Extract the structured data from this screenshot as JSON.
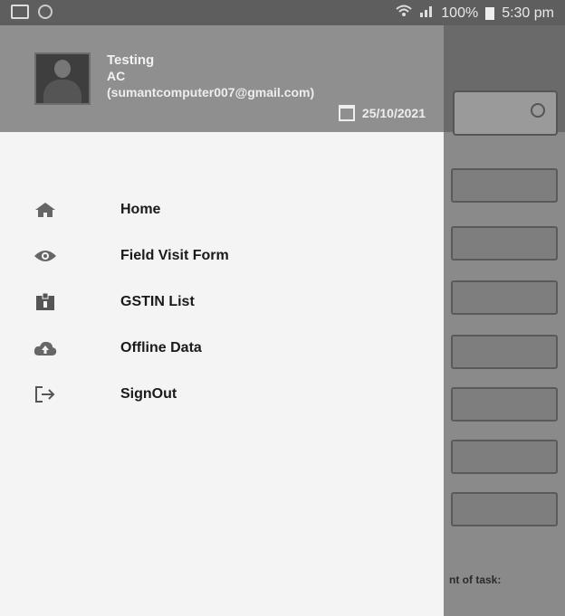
{
  "status_bar": {
    "battery": "100%",
    "time": "5:30 pm"
  },
  "drawer": {
    "header": {
      "user_name": "Testing",
      "user_role": "AC",
      "user_email": "(sumantcomputer007@gmail.com)",
      "date": "25/10/2021"
    },
    "menu": [
      {
        "label": "Home",
        "icon": "home-icon"
      },
      {
        "label": "Field Visit Form",
        "icon": "eye-icon"
      },
      {
        "label": "GSTIN List",
        "icon": "badge-icon"
      },
      {
        "label": "Offline Data",
        "icon": "cloud-upload-icon"
      },
      {
        "label": "SignOut",
        "icon": "signout-icon"
      }
    ]
  },
  "background": {
    "partial_text": "nt of task:"
  }
}
